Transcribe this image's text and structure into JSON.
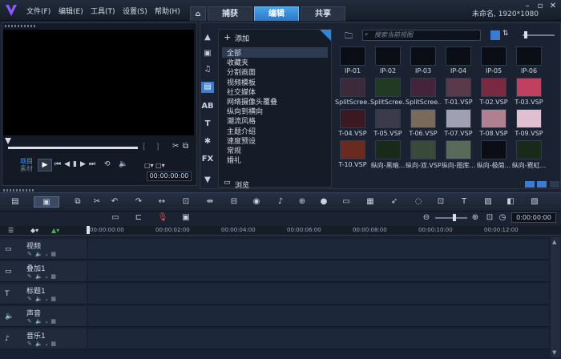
{
  "menu": [
    "文件(F)",
    "编辑(E)",
    "工具(T)",
    "设置(S)",
    "帮助(H)"
  ],
  "tabs": [
    {
      "label": "捕获"
    },
    {
      "label": "编辑"
    },
    {
      "label": "共享"
    }
  ],
  "project_info": "未命名, 1920*1080",
  "player": {
    "project_label": "项目",
    "clip_label": "素材",
    "timecode": "00:00:00:00"
  },
  "library": {
    "add_label": "添加",
    "browse_label": "浏览",
    "search_placeholder": "搜索当前视图",
    "categories": [
      "全部",
      "收藏夹",
      "分割画面",
      "视频模板",
      "社交媒体",
      "网络摄像头覆叠",
      "纵向到横向",
      "潮流风格",
      "主题介绍",
      "速度预设",
      "常规",
      "婚礼"
    ],
    "thumbs": [
      "IP-01",
      "IP-02",
      "IP-03",
      "IP-04",
      "IP-05",
      "IP-06",
      "SplitScree...",
      "SplitScree...",
      "SplitScree...",
      "T-01.VSP",
      "T-02.VSP",
      "T-03.VSP",
      "T-04.VSP",
      "T-05.VSP",
      "T-06.VSP",
      "T-07.VSP",
      "T-08.VSP",
      "T-09.VSP",
      "T-10.VSP",
      "纵向-黑暗...",
      "纵向-双.VSP",
      "纵向-图库...",
      "纵向-极简...",
      "纵向-霓虹..."
    ]
  },
  "timeline": {
    "timecode": "0:00:00:00",
    "ticks": [
      "00:00:00:00",
      "00:00:02:00",
      "00:00:04:00",
      "00:00:06:00",
      "00:00:08:00",
      "00:00:10:00",
      "00:00:12:00"
    ],
    "tracks": [
      "视频",
      "叠加1",
      "标题1",
      "声音",
      "音乐1"
    ]
  },
  "colors": {
    "accent": "#2b78c7",
    "bg": "#1b2230"
  }
}
